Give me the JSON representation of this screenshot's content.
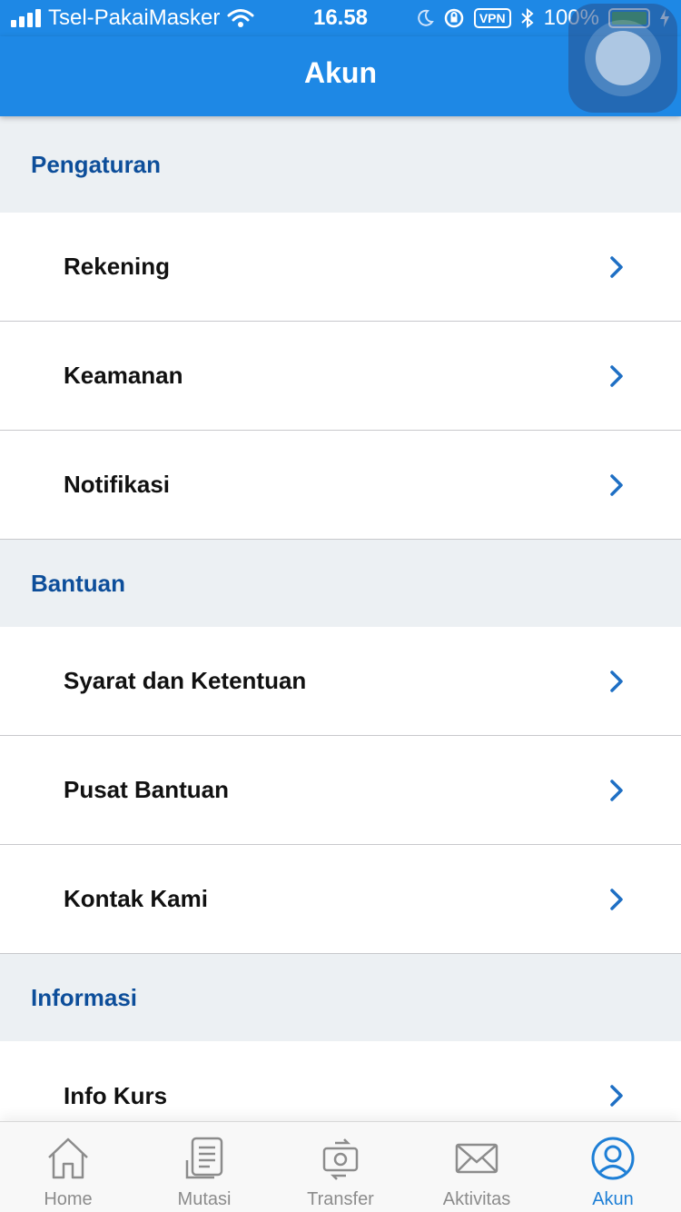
{
  "status_bar": {
    "carrier": "Tsel-PakaiMasker",
    "time": "16.58",
    "vpn": "VPN",
    "battery": "100%",
    "battery_level": 1.0
  },
  "nav": {
    "title": "Akun"
  },
  "sections": [
    {
      "title": "Pengaturan",
      "items": [
        "Rekening",
        "Keamanan",
        "Notifikasi"
      ]
    },
    {
      "title": "Bantuan",
      "items": [
        "Syarat dan Ketentuan",
        "Pusat Bantuan",
        "Kontak Kami"
      ]
    },
    {
      "title": "Informasi",
      "items": [
        "Info Kurs"
      ]
    }
  ],
  "tabs": [
    {
      "label": "Home",
      "icon": "home-icon",
      "active": false
    },
    {
      "label": "Mutasi",
      "icon": "document-icon",
      "active": false
    },
    {
      "label": "Transfer",
      "icon": "transfer-icon",
      "active": false
    },
    {
      "label": "Aktivitas",
      "icon": "mail-icon",
      "active": false
    },
    {
      "label": "Akun",
      "icon": "user-icon",
      "active": true
    }
  ],
  "colors": {
    "brand": "#1e88e5",
    "section_title": "#0d4e9a",
    "chevron": "#1e6fc4",
    "tab_inactive": "#8c8c8c",
    "tab_active": "#1e7fd6"
  }
}
